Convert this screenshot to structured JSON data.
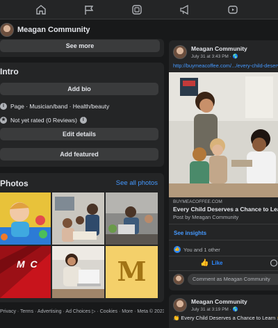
{
  "nav": {
    "icons": [
      "home-icon",
      "flag-icon",
      "marketplace-icon",
      "megaphone-icon",
      "video-icon"
    ]
  },
  "page": {
    "name": "Meagan Community"
  },
  "left": {
    "see_more": "See more",
    "intro_title": "Intro",
    "add_bio": "Add bio",
    "category": "Page · Musician/band · Health/beauty",
    "rating": "Not yet rated (0 Reviews)",
    "edit_details": "Edit details",
    "add_featured": "Add featured",
    "photos_title": "Photos",
    "see_all_photos": "See all photos",
    "mc_initials": "M C",
    "m_letter": "M",
    "footer": "Privacy · Terms · Advertising · Ad Choices ▷ · Cookies · More · Meta © 2023"
  },
  "post1": {
    "author": "Meagan Community",
    "time": "July 31 at 3:43 PM · 🌎",
    "link_text": "http://buymeacoffee.com/.../every-child-deserves",
    "domain": "BUYMEACOFFEE.COM",
    "headline": "Every Child Deserves a Chance to Learn",
    "post_by": "Post by Meagan Community",
    "see_insights": "See insights",
    "reactions": "You and 1 other",
    "like_label": "Like",
    "comment_placeholder": "Comment as Meagan Community"
  },
  "post2": {
    "author": "Meagan Community",
    "time": "July 31 at 3:19 PM · 🌎",
    "text": "👏 Every Child Deserves a Chance to Learn 👏"
  },
  "colors": {
    "background": "#18191a",
    "card": "#242526",
    "button": "#3a3b3c",
    "link": "#4599ff",
    "like_blue": "#2d88ff"
  }
}
